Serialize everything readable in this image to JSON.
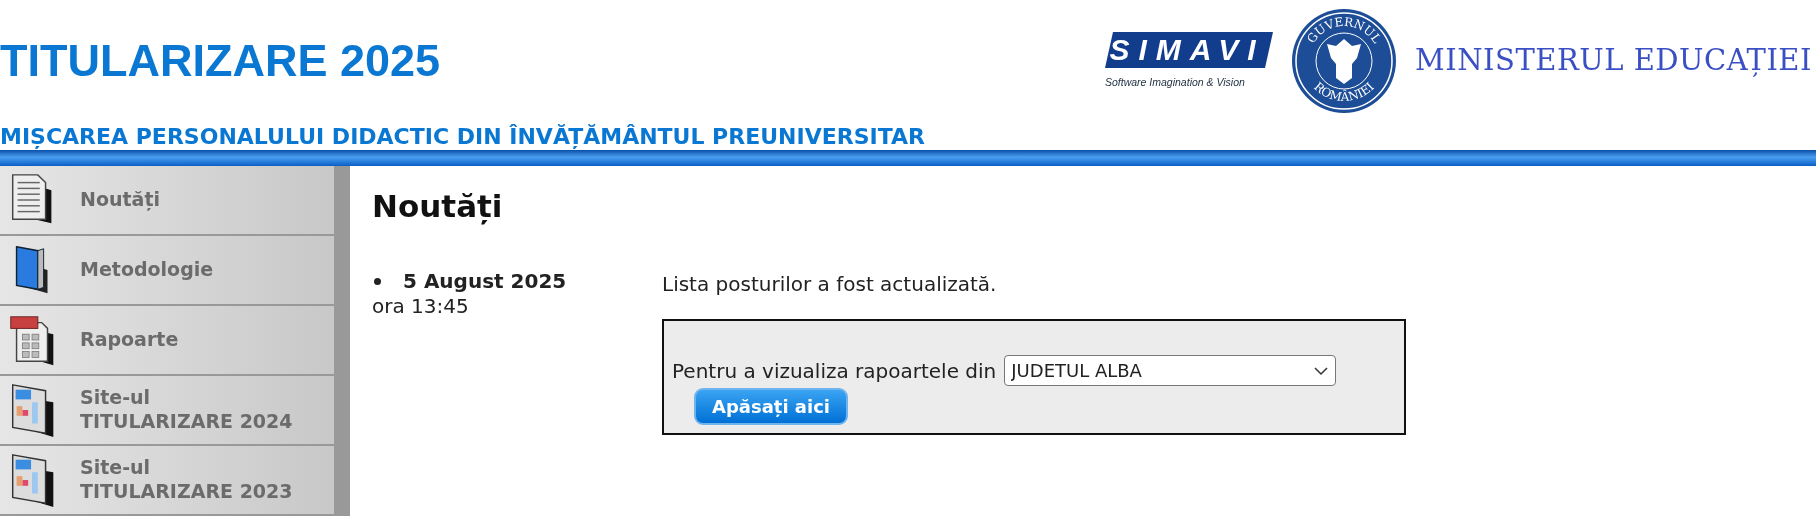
{
  "header": {
    "title": "TITULARIZARE 2025",
    "subtitle": "MIȘCAREA PERSONALULUI DIDACTIC DIN ÎNVĂȚĂMÂNTUL PREUNIVERSITAR",
    "logos": {
      "simavi": {
        "name": "SIMAVI",
        "tagline": "Software Imagination & Vision"
      },
      "emblem": {
        "top": "GUVERNUL",
        "bottom": "ROMÂNIEI"
      },
      "ministry": "MINISTERUL EDUCAȚIEI"
    }
  },
  "sidebar": {
    "items": [
      {
        "kind": "document",
        "label": "Noutăți"
      },
      {
        "kind": "book",
        "label": "Metodologie"
      },
      {
        "kind": "report",
        "label": "Rapoarte"
      },
      {
        "kind": "calendar",
        "label": "Site-ul\nTITULARIZARE 2024"
      },
      {
        "kind": "calendar",
        "label": "Site-ul\nTITULARIZARE 2023"
      }
    ]
  },
  "main": {
    "heading": "Noutăți",
    "news": [
      {
        "date": "5 August 2025",
        "time": "ora 13:45",
        "text": "Lista posturilor a fost actualizată.",
        "form": {
          "label": "Pentru a vizualiza rapoartele din",
          "select_value": "JUDETUL ALBA",
          "button": "Apăsați aici"
        }
      }
    ]
  }
}
